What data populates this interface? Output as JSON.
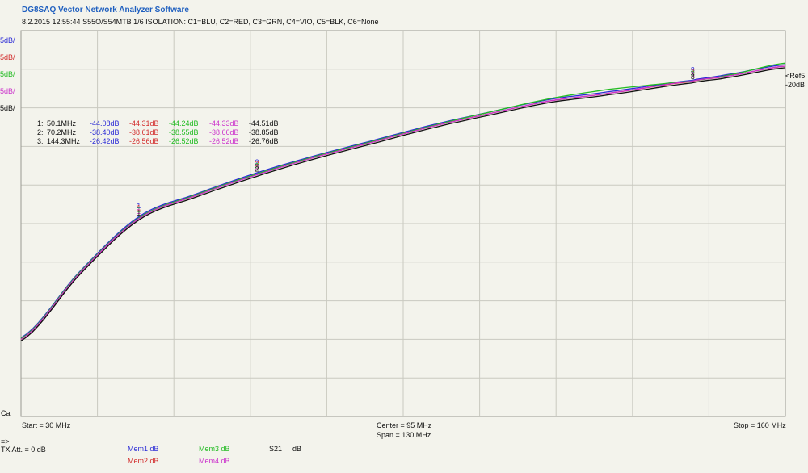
{
  "window": {
    "title": "DG8SAQ Vector Network Analyzer Software",
    "subtitle": "8.2.2015   12:55:44   S55O/S54MTB 1/6 ISOLATION: C1=BLU, C2=RED, C3=GRN, C4=VIO, C5=BLK, C6=None"
  },
  "scale_labels": [
    {
      "text": "5dB/",
      "color": "#2b2bd6"
    },
    {
      "text": "5dB/",
      "color": "#d22b2b"
    },
    {
      "text": "5dB/",
      "color": "#22bb22"
    },
    {
      "text": "5dB/",
      "color": "#cc33cc"
    },
    {
      "text": "5dB/",
      "color": "#111111"
    }
  ],
  "ref": {
    "label": "<Ref5",
    "value": "-20dB"
  },
  "cal_label": "Cal",
  "marker_table": {
    "rows": [
      {
        "id": "1:",
        "freq": "50.1MHz",
        "values": [
          "-44.08dB",
          "-44.31dB",
          "-44.24dB",
          "-44.33dB",
          "-44.51dB"
        ]
      },
      {
        "id": "2:",
        "freq": "70.2MHz",
        "values": [
          "-38.40dB",
          "-38.61dB",
          "-38.55dB",
          "-38.66dB",
          "-38.85dB"
        ]
      },
      {
        "id": "3:",
        "freq": "144.3MHz",
        "values": [
          "-26.42dB",
          "-26.56dB",
          "-26.52dB",
          "-26.52dB",
          "-26.76dB"
        ]
      }
    ],
    "colors": [
      "#2b2bd6",
      "#d22b2b",
      "#22bb22",
      "#cc33cc",
      "#111111"
    ]
  },
  "axis_labels": {
    "start": "Start = 30 MHz",
    "center": "Center = 95 MHz",
    "span": "Span = 130 MHz",
    "stop": "Stop = 160 MHz"
  },
  "footer": {
    "arrow": "=>",
    "tx_att": "TX Att. = 0 dB",
    "mem1": "Mem1  dB",
    "mem2": "Mem2  dB",
    "mem3": "Mem3  dB",
    "mem4": "Mem4  dB",
    "s21": "S21",
    "s21_unit": "dB"
  },
  "chart_data": {
    "type": "line",
    "xlim": [
      30,
      160
    ],
    "ylim": [
      -70,
      -20
    ],
    "x_unit": "MHz",
    "y_unit": "dB",
    "grid": true,
    "series": [
      {
        "name": "C1=BLU",
        "color": "#2b2bd6",
        "x": [
          30,
          40,
          50.1,
          60,
          70.2,
          80,
          90,
          100,
          110,
          120,
          130,
          144.3,
          150,
          160
        ],
        "y": [
          -59.8,
          -51.2,
          -44.08,
          -41.1,
          -38.4,
          -36.2,
          -34.2,
          -32.2,
          -30.5,
          -28.9,
          -27.9,
          -26.42,
          -25.7,
          -24.4
        ]
      },
      {
        "name": "C2=RED",
        "color": "#d22b2b",
        "x": [
          30,
          40,
          50.1,
          60,
          70.2,
          80,
          90,
          100,
          110,
          120,
          130,
          144.3,
          150,
          160
        ],
        "y": [
          -60.0,
          -51.4,
          -44.31,
          -41.3,
          -38.61,
          -36.4,
          -34.4,
          -32.4,
          -30.7,
          -29.1,
          -28.1,
          -26.56,
          -25.9,
          -24.6
        ]
      },
      {
        "name": "C3=GRN",
        "color": "#22bb22",
        "x": [
          30,
          40,
          50.1,
          60,
          70.2,
          80,
          90,
          100,
          110,
          120,
          130,
          144.3,
          150,
          160
        ],
        "y": [
          -59.9,
          -51.3,
          -44.24,
          -41.2,
          -38.55,
          -36.3,
          -34.3,
          -32.3,
          -30.5,
          -28.8,
          -27.6,
          -26.52,
          -25.8,
          -24.2
        ]
      },
      {
        "name": "C4=VIO",
        "color": "#cc33cc",
        "x": [
          30,
          40,
          50.1,
          60,
          70.2,
          80,
          90,
          100,
          110,
          120,
          130,
          144.3,
          150,
          160
        ],
        "y": [
          -60.0,
          -51.4,
          -44.33,
          -41.3,
          -38.66,
          -36.4,
          -34.4,
          -32.4,
          -30.7,
          -29.1,
          -28.1,
          -26.52,
          -25.9,
          -24.6
        ]
      },
      {
        "name": "C5=BLK",
        "color": "#111111",
        "x": [
          30,
          40,
          50.1,
          60,
          70.2,
          80,
          90,
          100,
          110,
          120,
          130,
          144.3,
          150,
          160
        ],
        "y": [
          -60.2,
          -51.6,
          -44.51,
          -41.5,
          -38.85,
          -36.6,
          -34.6,
          -32.6,
          -30.9,
          -29.3,
          -28.3,
          -26.76,
          -26.1,
          -24.8
        ]
      }
    ],
    "markers": [
      {
        "label": "1",
        "x": 50.1
      },
      {
        "label": "2",
        "x": 70.2
      },
      {
        "label": "3",
        "x": 144.3
      }
    ]
  }
}
